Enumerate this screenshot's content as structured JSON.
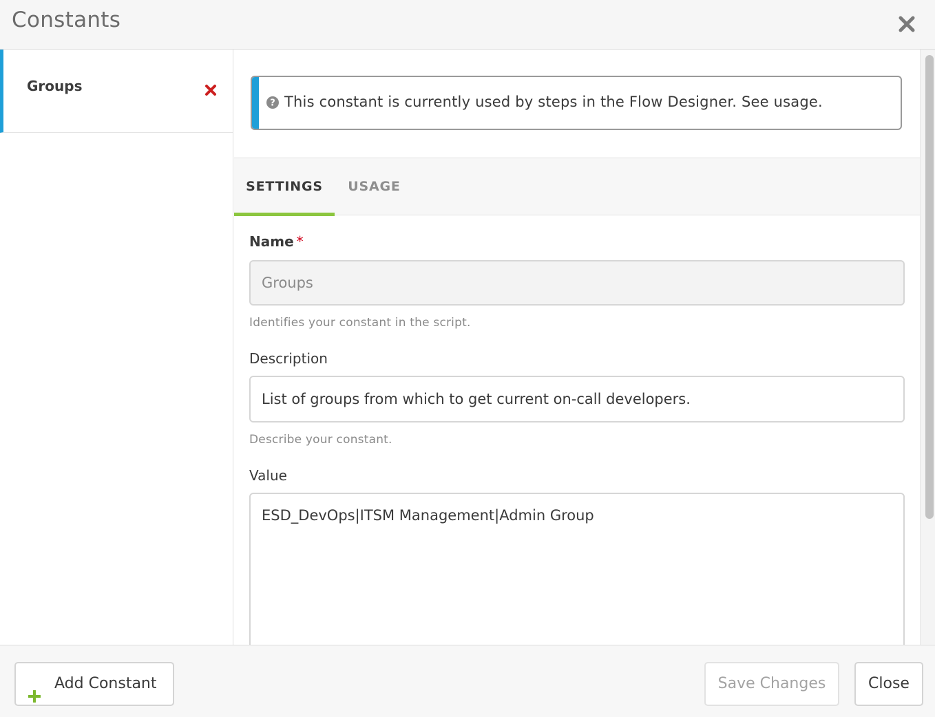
{
  "modal": {
    "title": "Constants",
    "close_icon": "close-icon"
  },
  "sidebar": {
    "items": [
      {
        "label": "Groups",
        "selected": true,
        "delete_icon": "delete-icon"
      }
    ],
    "accent_color": "#1f9fd8"
  },
  "banner": {
    "icon": "help-circle-icon",
    "text": "This constant is currently used by steps in the Flow Designer. See usage."
  },
  "tabs": [
    {
      "label": "SETTINGS",
      "active": true
    },
    {
      "label": "USAGE",
      "active": false
    }
  ],
  "tab_active_color": "#8cc63f",
  "form": {
    "name": {
      "label": "Name",
      "required_mark": "*",
      "value": "Groups",
      "help": "Identifies your constant in the script."
    },
    "description": {
      "label": "Description",
      "value": "List of groups from which to get current on-call developers.",
      "help": "Describe your constant."
    },
    "value": {
      "label": "Value",
      "value": "ESD_DevOps|ITSM Management|Admin Group"
    }
  },
  "footer": {
    "add_label": "Add Constant",
    "add_icon": "plus-icon",
    "save_label": "Save Changes",
    "close_label": "Close"
  }
}
